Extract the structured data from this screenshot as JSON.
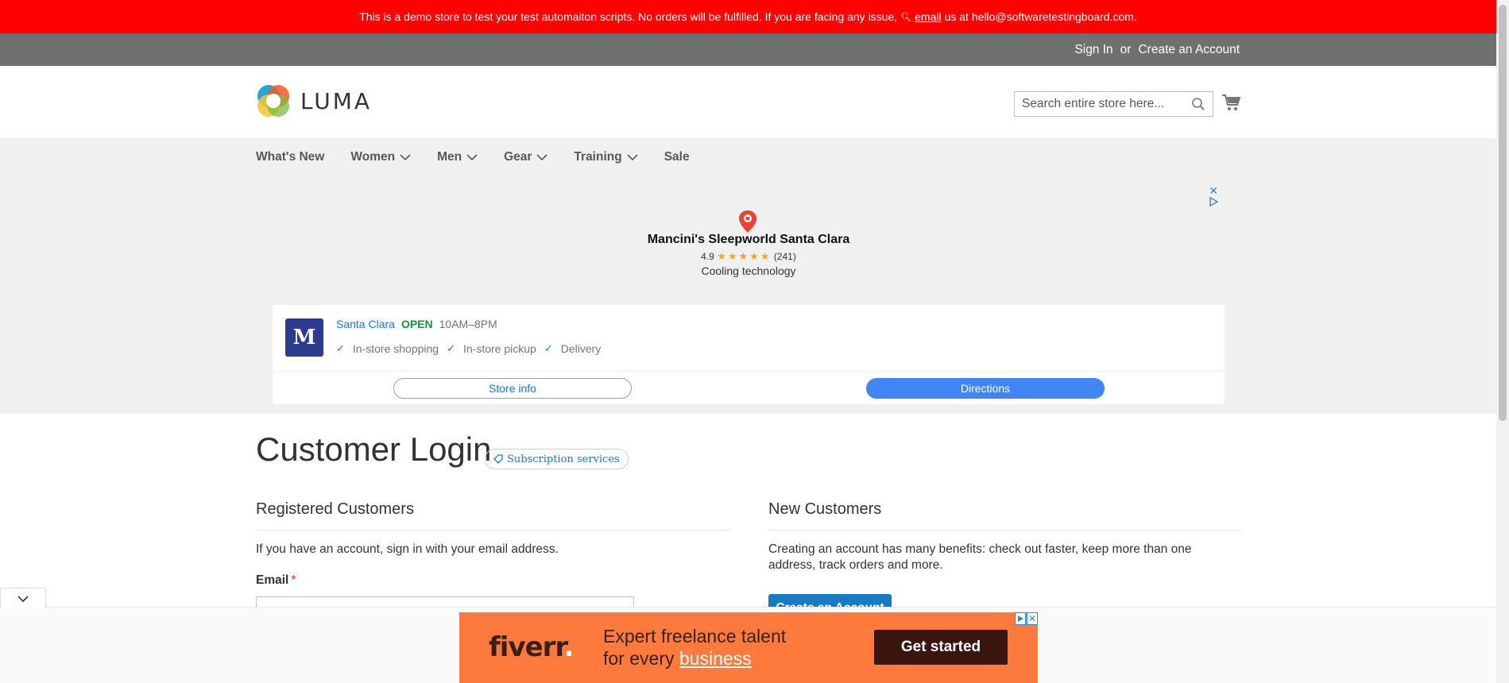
{
  "banner": {
    "text_before": "This is a demo store to test your test automaiton scripts. No orders will be fulfilled. If you are facing any issue,",
    "email_link": "email",
    "text_after": "us at hello@softwaretestingboard.com."
  },
  "panel": {
    "sign_in": "Sign In",
    "or": "or",
    "create_account": "Create an Account"
  },
  "header": {
    "logo_text": "LUMA",
    "search_placeholder": "Search entire store here...",
    "search_value": ""
  },
  "nav": {
    "items": [
      {
        "label": "What's New",
        "dropdown": false
      },
      {
        "label": "Women",
        "dropdown": true
      },
      {
        "label": "Men",
        "dropdown": true
      },
      {
        "label": "Gear",
        "dropdown": true
      },
      {
        "label": "Training",
        "dropdown": true
      },
      {
        "label": "Sale",
        "dropdown": false
      }
    ]
  },
  "store_ad": {
    "name": "Mancini's Sleepworld Santa Clara",
    "rating": "4.9",
    "stars": "★★★★★",
    "reviews": "(241)",
    "tagline": "Cooling technology",
    "logo_letter": "M",
    "city": "Santa Clara",
    "status": "OPEN",
    "hours": "10AM–8PM",
    "features": [
      "In-store shopping",
      "In-store pickup",
      "Delivery"
    ],
    "store_info_label": "Store info",
    "directions_label": "Directions",
    "close_glyph": "✕"
  },
  "main": {
    "page_title": "Customer Login",
    "badge_label": "Subscription services",
    "registered": {
      "title": "Registered Customers",
      "intro": "If you have an account, sign in with your email address.",
      "email_label": "Email",
      "required_mark": "*"
    },
    "new_customers": {
      "title": "New Customers",
      "text": "Creating an account has many benefits: check out faster, keep more than one address, track orders and more.",
      "button_label": "Create an Account"
    }
  },
  "bottom_ad": {
    "brand": "fiverr",
    "brand_dot": ".",
    "line1": "Expert freelance talent",
    "line2_prefix": "for every",
    "line2_link": "business",
    "cta": "Get started",
    "close_glyph": "✕"
  },
  "colors": {
    "banner_bg": "#ff0101",
    "panel_bg": "#6e716e",
    "nav_bg": "#f0f0f0",
    "primary_button": "#1979c3",
    "fiverr_orange": "#ff7b3d",
    "directions_blue": "#4285f4",
    "open_green": "#1e8e3e"
  }
}
